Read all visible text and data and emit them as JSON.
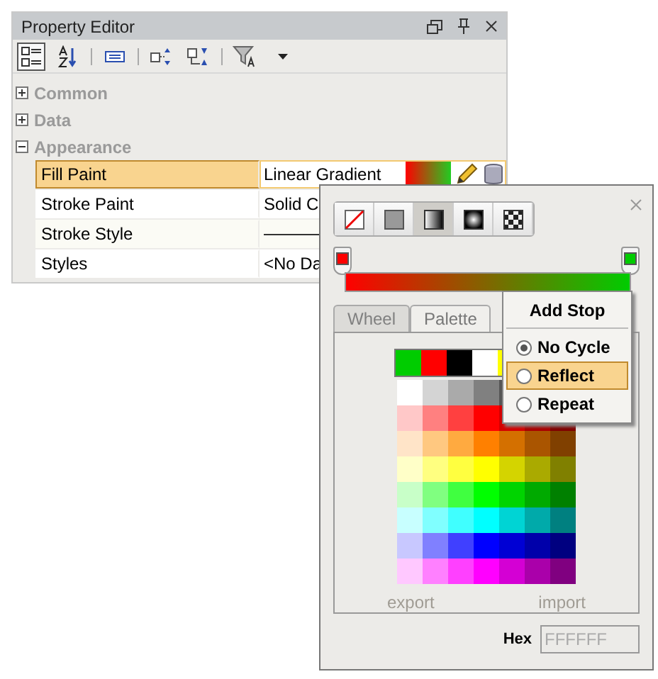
{
  "window": {
    "title": "Property Editor"
  },
  "categories": [
    {
      "label": "Common",
      "expanded": false
    },
    {
      "label": "Data",
      "expanded": false
    },
    {
      "label": "Appearance",
      "expanded": true
    }
  ],
  "properties": [
    {
      "name": "Fill Paint",
      "kind": "gradient",
      "value": "Linear Gradient",
      "selected": true
    },
    {
      "name": "Stroke Paint",
      "kind": "text",
      "value": "Solid C",
      "selected": false
    },
    {
      "name": "Stroke Style",
      "kind": "line",
      "selected": false
    },
    {
      "name": "Styles",
      "kind": "text",
      "value": "<No Da",
      "selected": false
    }
  ],
  "paint_popup": {
    "modes": [
      {
        "kind": "none",
        "selected": false
      },
      {
        "kind": "solid",
        "selected": false
      },
      {
        "kind": "linear",
        "selected": true
      },
      {
        "kind": "radial",
        "selected": false
      },
      {
        "kind": "pattern",
        "selected": false
      }
    ],
    "stops": [
      {
        "color": "#ff0000"
      },
      {
        "color": "#00cc00"
      }
    ],
    "tabs": [
      {
        "label": "Wheel",
        "selected": false
      },
      {
        "label": "Palette",
        "selected": true
      }
    ],
    "recent": [
      {
        "color": "#00cc00"
      },
      {
        "color": "#ff0000"
      },
      {
        "color": "#000000"
      },
      {
        "color": "#ffffff"
      },
      {
        "color": "#ffff00"
      }
    ],
    "palette": [
      {
        "swatches": [
          {
            "color": "#ffffff"
          },
          {
            "color": "#d4d4d4"
          },
          {
            "color": "#aaaaaa"
          },
          {
            "color": "#808080"
          },
          {
            "color": "#555555"
          }
        ]
      },
      {
        "swatches": [
          {
            "color": "#ffc8c8"
          },
          {
            "color": "#ff8080"
          },
          {
            "color": "#ff4040"
          },
          {
            "color": "#ff0000"
          },
          {
            "color": "#d40000"
          },
          {
            "color": "#aa0000"
          },
          {
            "color": "#800000"
          }
        ]
      },
      {
        "swatches": [
          {
            "color": "#ffe4c8"
          },
          {
            "color": "#ffc880"
          },
          {
            "color": "#ffaa40"
          },
          {
            "color": "#ff8000"
          },
          {
            "color": "#d47000"
          },
          {
            "color": "#aa5500"
          },
          {
            "color": "#804000"
          }
        ]
      },
      {
        "swatches": [
          {
            "color": "#ffffc8"
          },
          {
            "color": "#ffff80"
          },
          {
            "color": "#ffff40"
          },
          {
            "color": "#ffff00"
          },
          {
            "color": "#d4d400"
          },
          {
            "color": "#aaaa00"
          },
          {
            "color": "#808000"
          }
        ]
      },
      {
        "swatches": [
          {
            "color": "#c8ffc8"
          },
          {
            "color": "#80ff80"
          },
          {
            "color": "#40ff40"
          },
          {
            "color": "#00ff00"
          },
          {
            "color": "#00d400"
          },
          {
            "color": "#00aa00"
          },
          {
            "color": "#008000"
          }
        ]
      },
      {
        "swatches": [
          {
            "color": "#c8ffff"
          },
          {
            "color": "#80ffff"
          },
          {
            "color": "#40ffff"
          },
          {
            "color": "#00ffff"
          },
          {
            "color": "#00d4d4"
          },
          {
            "color": "#00aaaa"
          },
          {
            "color": "#008080"
          }
        ]
      },
      {
        "swatches": [
          {
            "color": "#c8c8ff"
          },
          {
            "color": "#8080ff"
          },
          {
            "color": "#4040ff"
          },
          {
            "color": "#0000ff"
          },
          {
            "color": "#0000d4"
          },
          {
            "color": "#0000aa"
          },
          {
            "color": "#000080"
          }
        ]
      },
      {
        "swatches": [
          {
            "color": "#ffc8ff"
          },
          {
            "color": "#ff80ff"
          },
          {
            "color": "#ff40ff"
          },
          {
            "color": "#ff00ff"
          },
          {
            "color": "#d400d4"
          },
          {
            "color": "#aa00aa"
          },
          {
            "color": "#800080"
          }
        ]
      }
    ],
    "links": [
      "export",
      "import"
    ],
    "hex": {
      "label": "Hex",
      "placeholder": "FFFFFF"
    }
  },
  "context_menu": {
    "title": "Add Stop",
    "options": [
      {
        "label": "No Cycle",
        "selected": true,
        "highlighted": false
      },
      {
        "label": "Reflect",
        "selected": false,
        "highlighted": true
      },
      {
        "label": "Repeat",
        "selected": false,
        "highlighted": false
      }
    ]
  }
}
